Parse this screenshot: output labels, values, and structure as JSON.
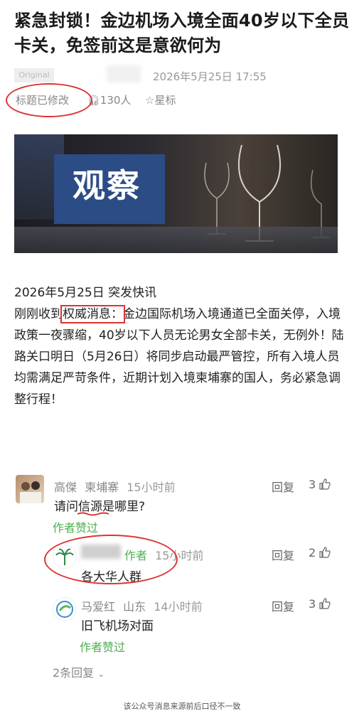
{
  "article": {
    "title": "紧急封锁！金边机场入境全面40岁以下全员卡关，免签前这是意欲何为",
    "original_badge": "Original",
    "date": "2026年5月25日 17:55",
    "title_modified": "标题已修改",
    "listeners": "130人",
    "star_label": "星标",
    "hero_text": "观察",
    "body_lines": [
      "2026年5月25日 突发快讯",
      "刚刚收到",
      "权威消息：",
      "金边国际机场入境通道已全面关停，入境政策一夜骤缩，40岁以下人员无论男女全部卡关，无例外！陆路关口明日（5月26日）将同步启动最严管控，所有入境人员均需满足严苛条件，近期计划入境柬埔寨的国人，务必紧急调整行程！"
    ]
  },
  "comments": [
    {
      "name": "高傑",
      "location": "柬埔寨",
      "time": "15小时前",
      "text": "请问信源是哪里?",
      "author_liked": "作者赞过",
      "reply_label": "回复",
      "likes": "3"
    },
    {
      "name_role": "作者",
      "time": "15小时前",
      "text": "各大华人群",
      "reply_label": "回复",
      "likes": "2"
    },
    {
      "name": "马爱红",
      "location": "山东",
      "time": "14小时前",
      "text": "旧飞机场对面",
      "author_liked": "作者赞过",
      "reply_label": "回复",
      "likes": "3"
    }
  ],
  "more_replies": "2条回复",
  "footer": "该公众号消息来源前后口径不一致",
  "colors": {
    "annotation_red": "#d33333",
    "liked_green": "#4caf50"
  }
}
